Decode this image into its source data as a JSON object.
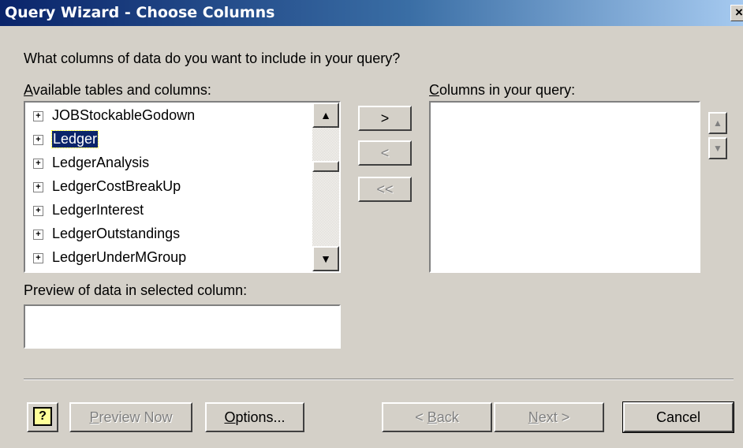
{
  "window": {
    "title": "Query Wizard - Choose Columns",
    "close_label": "×"
  },
  "prompt": "What columns of data do you want to include in your query?",
  "available": {
    "label": "Available tables and columns:",
    "items": [
      {
        "label": "JOBStockableGodown",
        "selected": false
      },
      {
        "label": "Ledger",
        "selected": true
      },
      {
        "label": "LedgerAnalysis",
        "selected": false
      },
      {
        "label": "LedgerCostBreakUp",
        "selected": false
      },
      {
        "label": "LedgerInterest",
        "selected": false
      },
      {
        "label": "LedgerOutstandings",
        "selected": false
      },
      {
        "label": "LedgerUnderMGroup",
        "selected": false
      }
    ]
  },
  "move_buttons": {
    "add": ">",
    "remove": "<",
    "remove_all": "<<"
  },
  "query_columns": {
    "label": "Columns in your query:",
    "items": []
  },
  "preview": {
    "label": "Preview of data in selected column:",
    "value": ""
  },
  "footer": {
    "help": "?",
    "preview_now": "Preview Now",
    "options": "Options...",
    "back": "< Back",
    "next": "Next >",
    "cancel": "Cancel"
  },
  "colors": {
    "title_start": "#0a246a",
    "title_end": "#a6caf0",
    "face": "#d4d0c8",
    "selection": "#0a246a"
  }
}
